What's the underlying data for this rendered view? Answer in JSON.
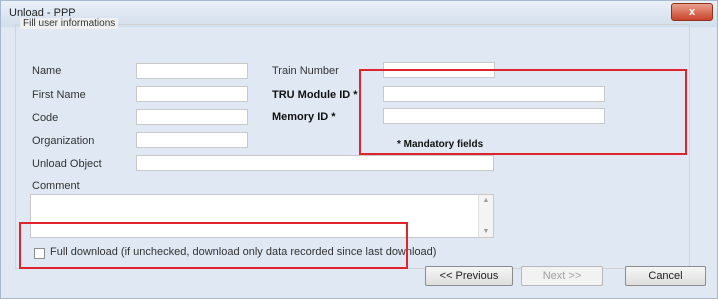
{
  "window": {
    "title": "Unload - PPP",
    "close_glyph": "x"
  },
  "group": {
    "label": "Fill user informations"
  },
  "fields": {
    "name": {
      "label": "Name",
      "value": ""
    },
    "first_name": {
      "label": "First Name",
      "value": ""
    },
    "code": {
      "label": "Code",
      "value": ""
    },
    "organization": {
      "label": "Organization",
      "value": ""
    },
    "unload_object": {
      "label": "Unload Object",
      "value": ""
    },
    "train_number": {
      "label": "Train Number",
      "value": ""
    },
    "tru_module_id": {
      "label": "TRU Module ID *",
      "value": ""
    },
    "memory_id": {
      "label": "Memory ID *",
      "value": ""
    },
    "comment": {
      "label": "Comment",
      "value": ""
    }
  },
  "mandatory_note": "* Mandatory fields",
  "full_download": {
    "label": "Full download (if unchecked, download only data recorded since last download)",
    "checked": false
  },
  "buttons": {
    "previous": "<< Previous",
    "next": "Next >>",
    "cancel": "Cancel"
  },
  "icons": {
    "scroll_up": "▲",
    "scroll_down": "▼"
  },
  "colors": {
    "highlight_box": "#e0242b",
    "close_button": "#c9432b"
  }
}
